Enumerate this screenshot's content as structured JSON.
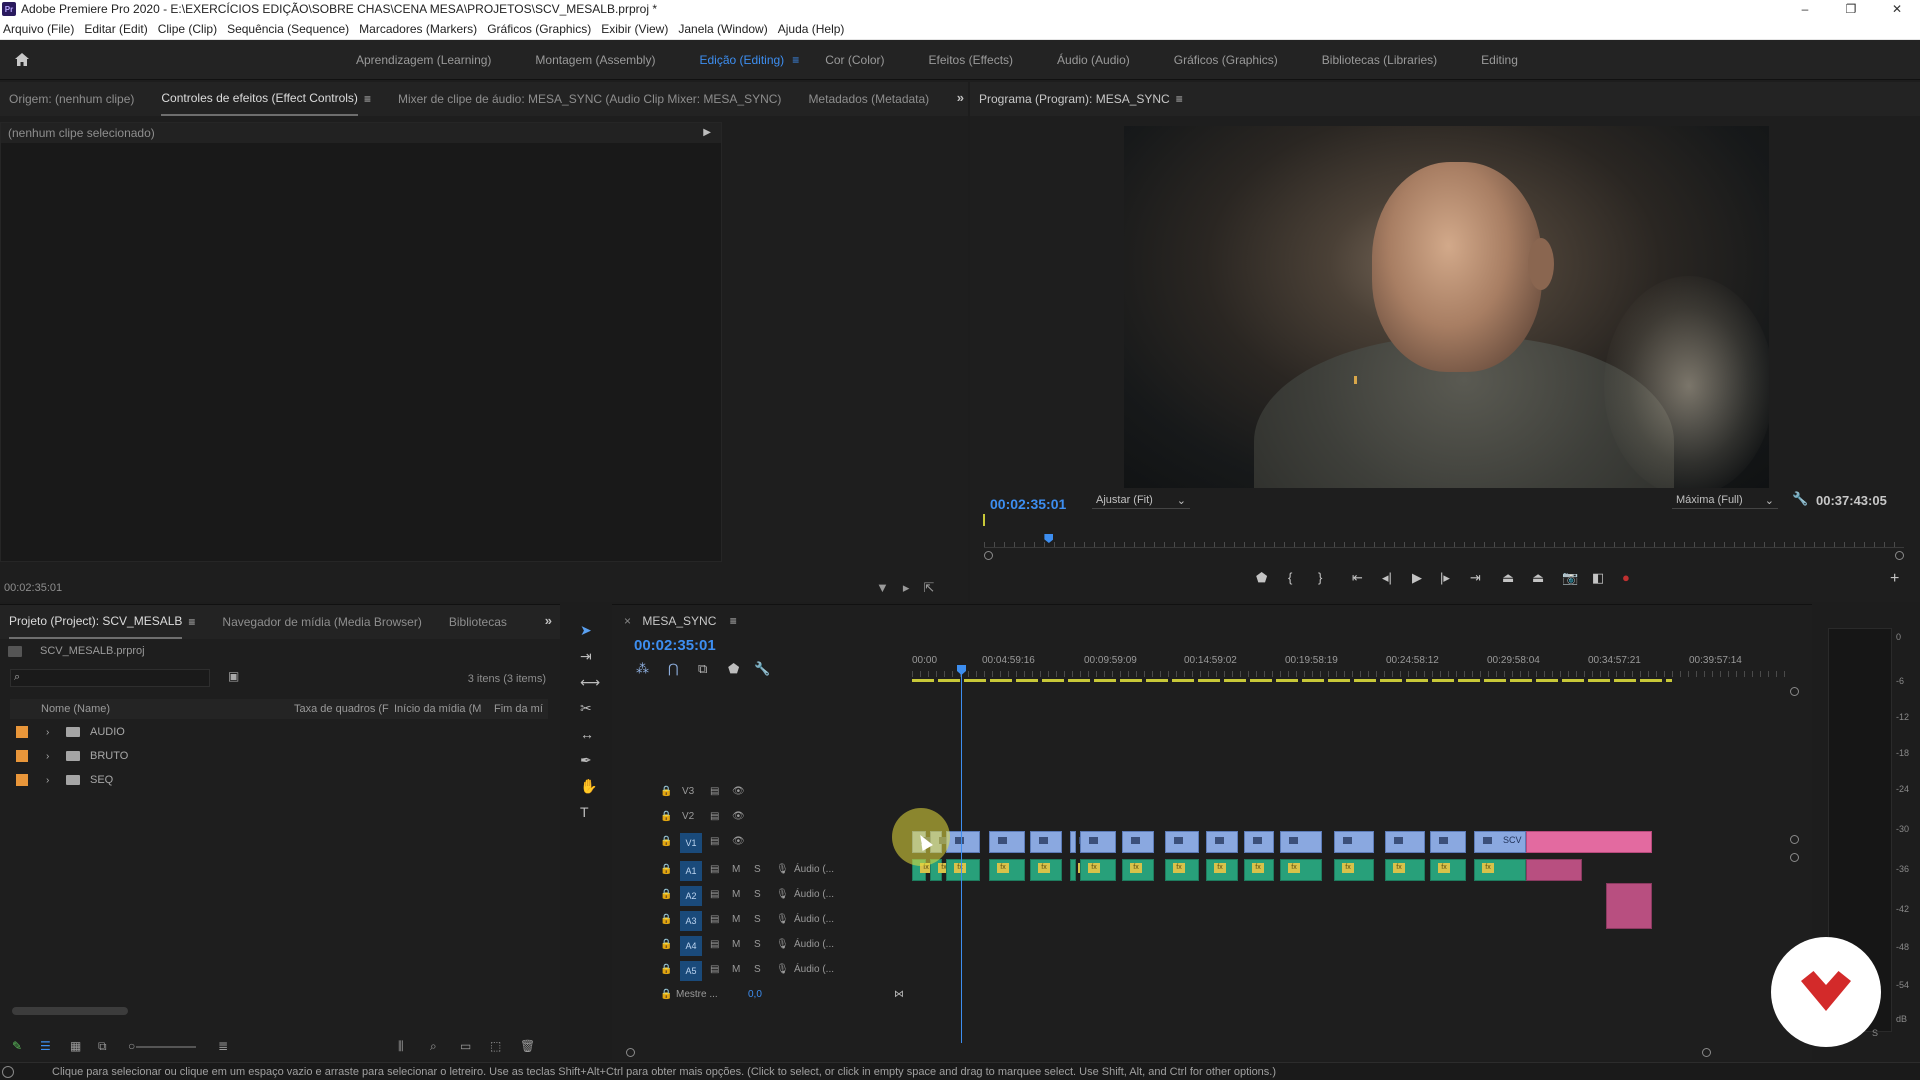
{
  "titlebar": {
    "logo": "Pr",
    "title": "Adobe Premiere Pro 2020 - E:\\EXERCÍCIOS EDIÇÃO\\SOBRE CHAS\\CENA MESA\\PROJETOS\\SCV_MESALB.prproj *",
    "minimize": "–",
    "restore": "❐",
    "close": "✕"
  },
  "menubar": {
    "items": [
      "Arquivo (File)",
      "Editar (Edit)",
      "Clipe (Clip)",
      "Sequência (Sequence)",
      "Marcadores (Markers)",
      "Gráficos (Graphics)",
      "Exibir (View)",
      "Janela (Window)",
      "Ajuda (Help)"
    ]
  },
  "workspaces": {
    "items": [
      "Aprendizagem (Learning)",
      "Montagem (Assembly)",
      "Edição (Editing)",
      "Cor (Color)",
      "Efeitos (Effects)",
      "Áudio (Audio)",
      "Gráficos (Graphics)",
      "Bibliotecas (Libraries)",
      "Editing"
    ],
    "active_index": 2
  },
  "effects_panel": {
    "tabs": [
      "Origem: (nenhum clipe)",
      "Controles de efeitos (Effect Controls)",
      "Mixer de clipe de áudio: MESA_SYNC (Audio Clip Mixer: MESA_SYNC)",
      "Metadados (Metadata)"
    ],
    "active_tab": 1,
    "no_clip": "(nenhum clipe selecionado)",
    "timecode": "00:02:35:01"
  },
  "program_monitor": {
    "tab": "Programa (Program): MESA_SYNC",
    "timecode": "00:02:35:01",
    "fit": "Ajustar (Fit)",
    "resolution": "Máxima (Full)",
    "duration": "00:37:43:05",
    "playhead_fraction": 0.07
  },
  "project_panel": {
    "tabs": [
      "Projeto (Project): SCV_MESALB",
      "Navegador de mídia (Media Browser)",
      "Bibliotecas"
    ],
    "file": "SCV_MESALB.prproj",
    "search_placeholder": "",
    "count": "3 itens (3 items)",
    "columns": [
      "Nome (Name)",
      "Taxa de quadros (F",
      "Início da mídia (M",
      "Fim da mí"
    ],
    "items": [
      {
        "name": "AUDIO",
        "color": "#e8963a"
      },
      {
        "name": "BRUTO",
        "color": "#e8963a"
      },
      {
        "name": "SEQ",
        "color": "#e8963a"
      }
    ]
  },
  "timeline": {
    "tab": "MESA_SYNC",
    "timecode": "00:02:35:01",
    "ruler_labels": [
      "00:00",
      "00:04:59:16",
      "00:09:59:09",
      "00:14:59:02",
      "00:19:58:19",
      "00:24:58:12",
      "00:29:58:04",
      "00:34:57:21",
      "00:39:57:14"
    ],
    "video_tracks": [
      "V3",
      "V2",
      "V1"
    ],
    "audio_tracks": [
      "A1",
      "A2",
      "A3",
      "A4",
      "A5"
    ],
    "audio_name": "Áudio (...",
    "mute_label": "M",
    "solo_label": "S",
    "master_label": "Mestre ...",
    "master_value": "0,0",
    "clip_label": "SCV"
  },
  "meters": {
    "labels": [
      "0",
      "-6",
      "-12",
      "-18",
      "-24",
      "-30",
      "-36",
      "-42",
      "-48",
      "-54",
      "dB"
    ],
    "solo_label": "S"
  },
  "statusbar": {
    "message": "Clique para selecionar ou clique em um espaço vazio e arraste para selecionar o letreiro. Use as teclas Shift+Alt+Ctrl para obter mais opções. (Click to select, or click in empty space and drag to marquee select. Use Shift, Alt, and Ctrl for other options.)"
  },
  "colors": {
    "accent_blue": "#3d8ef0",
    "video_clip": "#8aa8e0",
    "audio_clip": "#28a07a",
    "pink_clip": "#e36aa0",
    "label_orange": "#e8963a"
  }
}
